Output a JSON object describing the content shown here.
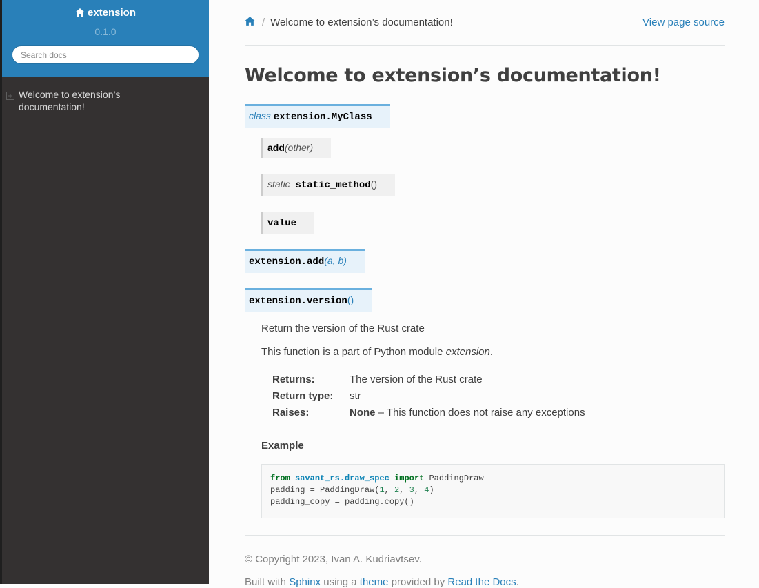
{
  "sidebar": {
    "project_name": "extension",
    "version": "0.1.0",
    "search_placeholder": "Search docs",
    "nav_items": [
      {
        "label": "Welcome to extension’s documentation!",
        "icon": "expand-plus-icon"
      }
    ]
  },
  "breadcrumbs": {
    "home_icon": "home-icon",
    "separator": "/",
    "current": "Welcome to extension’s documentation!",
    "view_source": "View page source"
  },
  "page_title": "Welcome to extension’s documentation!",
  "api": {
    "class_sig": {
      "keyword": "class",
      "name": "extension.MyClass"
    },
    "members": [
      {
        "prefix": "",
        "name": "add",
        "params": "(other)"
      },
      {
        "prefix": "static",
        "name": "static_method",
        "params": "()"
      },
      {
        "prefix": "",
        "name": "value",
        "params": ""
      }
    ],
    "add_sig": {
      "name": "extension.add",
      "params": "(a, b)"
    },
    "version_sig": {
      "name": "extension.version",
      "params": "()"
    },
    "version_desc": "Return the version of the Rust crate",
    "module_note_prefix": "This function is a part of Python module ",
    "module_note_module": "extension",
    "module_note_suffix": ".",
    "fields": [
      {
        "name": "Returns:",
        "value_bold": "",
        "value": "The version of the Rust crate"
      },
      {
        "name": "Return type:",
        "value_bold": "",
        "value": "str"
      },
      {
        "name": "Raises:",
        "value_bold": "None",
        "value": " – This function does not raise any exceptions"
      }
    ],
    "example_heading": "Example",
    "code": {
      "line1": {
        "kw_from": "from",
        "module": "savant_rs.draw_spec",
        "kw_import": "import",
        "name": "PaddingDraw"
      },
      "line2": {
        "pre": "padding = PaddingDraw(",
        "n1": "1",
        "n2": "2",
        "n3": "3",
        "n4": "4",
        "post": ")"
      },
      "line3": "padding_copy = padding.copy()"
    }
  },
  "footer": {
    "copyright": "© Copyright 2023, Ivan A. Kudriavtsev.",
    "built_with": "Built with",
    "sphinx": "Sphinx",
    "using_a": "using a",
    "theme": "theme",
    "provided_by": "provided by",
    "rtd": "Read the Docs",
    "period": "."
  },
  "colors": {
    "sidebar_bg": "#343131",
    "header_bg": "#2980b9",
    "link": "#2980b9",
    "signature_bg": "#e7f2fa",
    "signature_border": "#6ab0de",
    "member_bg": "#f0f0f0"
  }
}
